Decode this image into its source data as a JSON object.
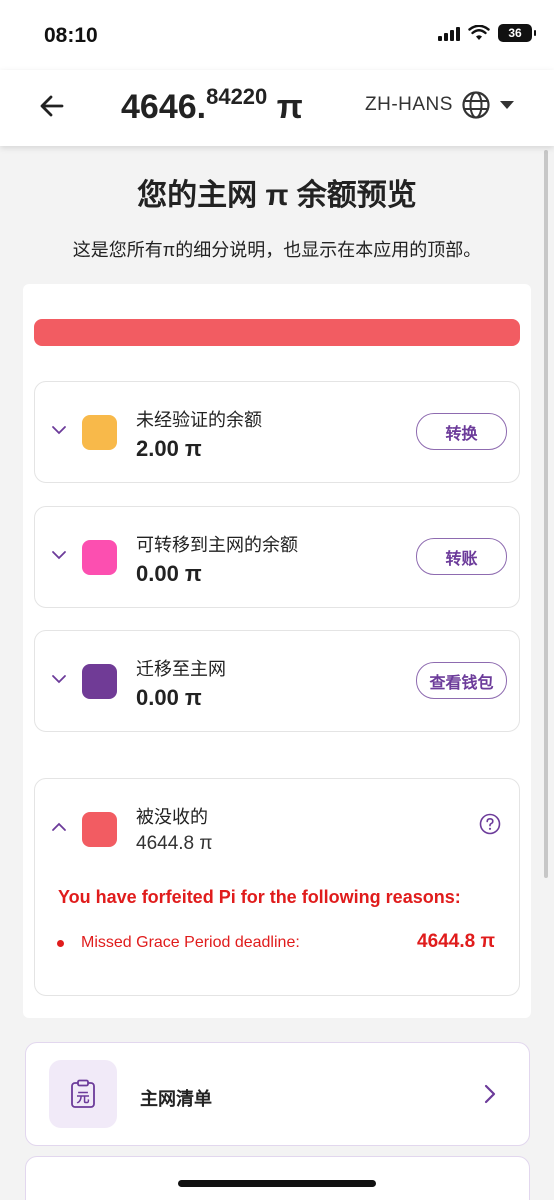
{
  "status_bar": {
    "time": "08:10",
    "battery": "36",
    "icons": [
      "signal-icon",
      "wifi-icon",
      "battery-icon"
    ]
  },
  "header": {
    "balance_int": "4646.",
    "balance_dec": "84220",
    "balance_unit": " π",
    "language": "ZH-HANS",
    "icons": [
      "back-arrow-icon",
      "globe-icon",
      "caret-down-icon"
    ]
  },
  "page": {
    "title": "您的主网 π 余额预览",
    "subtitle": "这是您所有π的细分说明，也显示在本应用的顶部。"
  },
  "balances": [
    {
      "label": "未经验证的余额",
      "value": "2.00 π",
      "color": "#f8b94a",
      "action": "转换"
    },
    {
      "label": "可转移到主网的余额",
      "value": "0.00 π",
      "color": "#fc4fb0",
      "action": "转账"
    },
    {
      "label": "迁移至主网",
      "value": "0.00 π",
      "color": "#703b96",
      "action": "查看钱包"
    }
  ],
  "forfeited": {
    "label": "被没收的",
    "value": "4644.8 π",
    "color": "#f25c62",
    "message": "You have forfeited Pi for the following reasons:",
    "reasons": [
      {
        "text": "Missed Grace Period deadline:",
        "value": "4644.8 π"
      }
    ]
  },
  "checklist": {
    "label": "主网清单",
    "icon_glyph": "元"
  },
  "colors": {
    "accent_purple": "#6c3b9a",
    "alert_red": "#e01c1c",
    "bar_red": "#f25c62"
  }
}
